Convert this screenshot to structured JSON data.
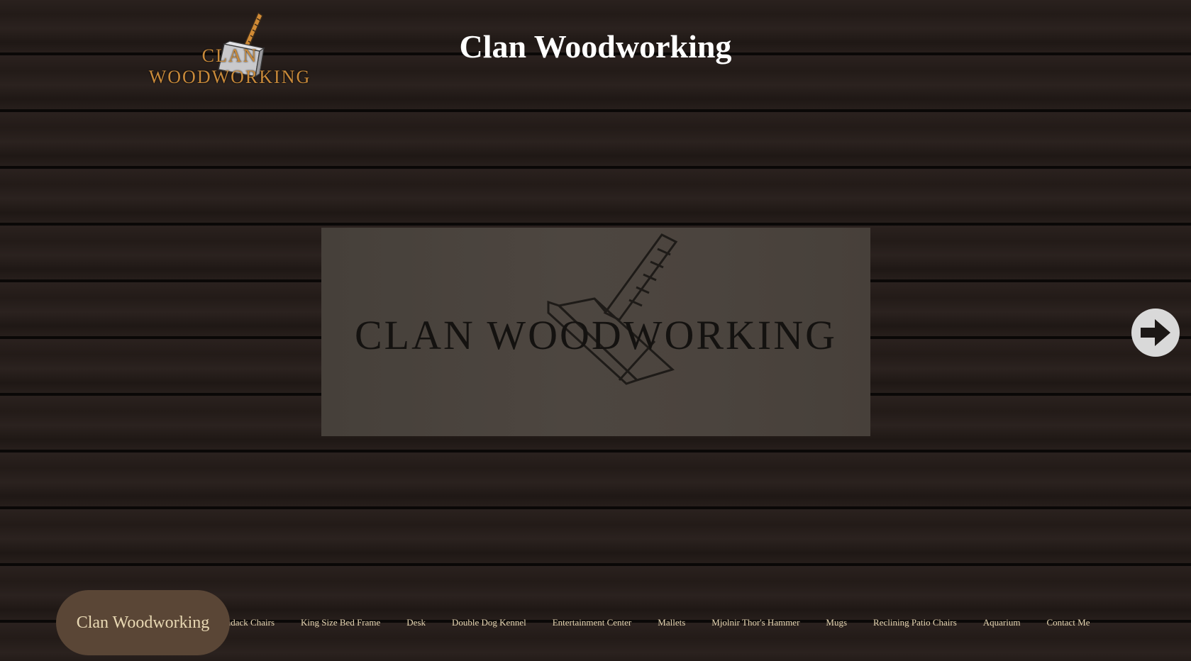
{
  "header": {
    "logo_icon": "hammer-logo-icon",
    "logo_text": "CLAN WOODWORKING",
    "title": "Clan Woodworking"
  },
  "slideshow": {
    "slide_text": "CLAN WOODWORKING",
    "next_icon": "arrow-right-circle-icon"
  },
  "nav": {
    "brand": "Clan Woodworking",
    "items": [
      {
        "label": "Adirondack Chairs"
      },
      {
        "label": "King Size Bed Frame"
      },
      {
        "label": "Desk"
      },
      {
        "label": "Double Dog Kennel"
      },
      {
        "label": "Entertainment Center"
      },
      {
        "label": "Mallets"
      },
      {
        "label": "Mjolnir Thor's Hammer"
      },
      {
        "label": "Mugs"
      },
      {
        "label": "Reclining Patio Chairs"
      },
      {
        "label": "Aquarium"
      },
      {
        "label": "Contact Me"
      }
    ]
  },
  "colors": {
    "background": "#231b18",
    "title": "#ffffff",
    "logo_text": "#c98a3a",
    "nav_text": "#e7d7b3",
    "brand_pill": "#5a4636",
    "slide_bg": "#4b443e",
    "arrow": "#d9d9d9"
  }
}
